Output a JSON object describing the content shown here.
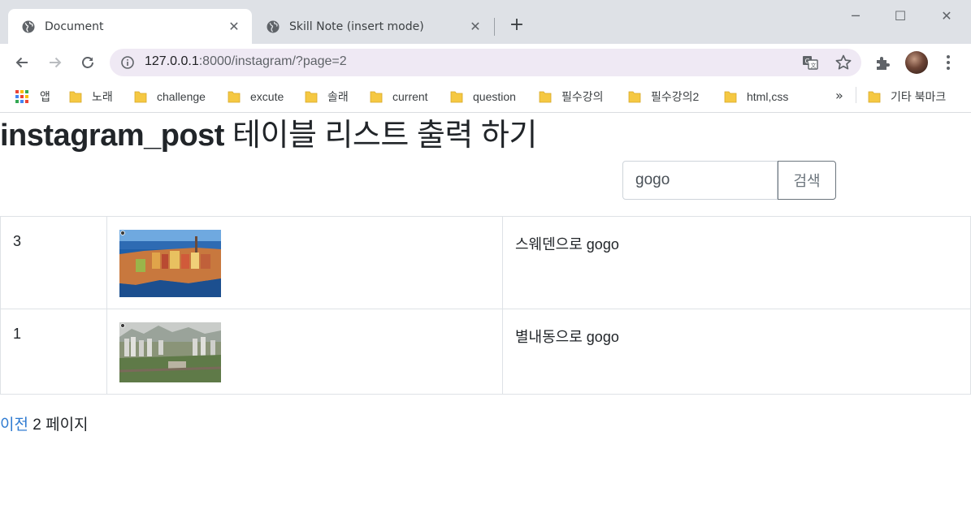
{
  "browser": {
    "tabs": [
      {
        "title": "Document",
        "active": true,
        "icon": "globe-icon"
      },
      {
        "title": "Skill Note (insert mode)",
        "active": false,
        "icon": "globe-icon"
      }
    ],
    "url_host": "127.0.0.1",
    "url_rest": ":8000/instagram/?page=2",
    "bookmarks": [
      "앱",
      "노래",
      "challenge",
      "excute",
      "솔래",
      "current",
      "question",
      "필수강의",
      "필수강의2",
      "html,css"
    ],
    "bookmarks_more": "»",
    "other_bookmarks": "기타 북마크"
  },
  "page": {
    "heading_bold": "instagram_post",
    "heading_rest": "테이블 리스트 출력 하기",
    "search": {
      "value": "gogo",
      "button_label": "검색"
    },
    "rows": [
      {
        "id": "3",
        "caption": "스웨덴으로 gogo",
        "image": "stockholm-city-photo"
      },
      {
        "id": "1",
        "caption": "별내동으로 gogo",
        "image": "byeollae-aerial-photo"
      }
    ],
    "pagination": {
      "prev_label": "이전",
      "current_text": "2 페이지"
    }
  },
  "colors": {
    "tabstrip": "#dee1e6",
    "omnibox": "#efe9f4",
    "link": "#2f7bd1",
    "border": "#dee2e6",
    "button": "#6c757d"
  }
}
